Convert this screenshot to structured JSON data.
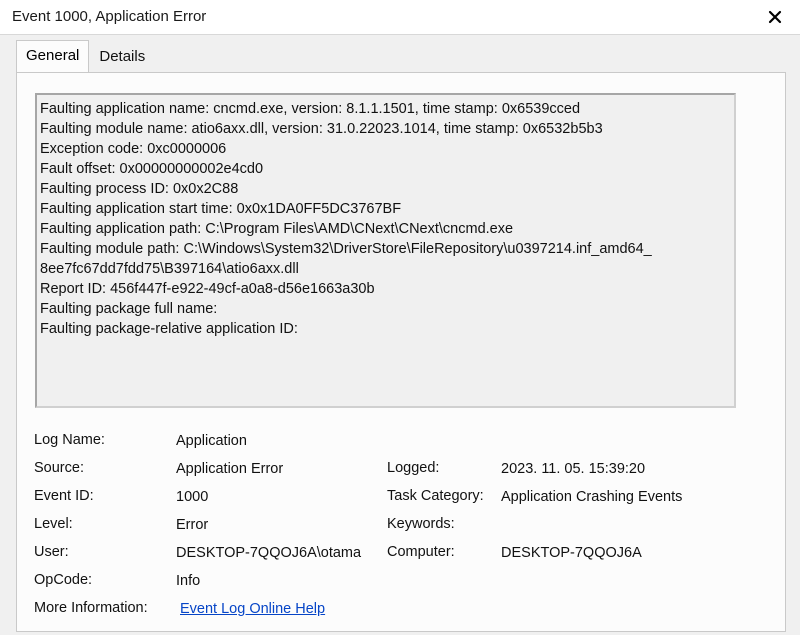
{
  "window": {
    "title": "Event 1000, Application Error",
    "close_icon": "close-icon"
  },
  "tabs": [
    {
      "label": "General",
      "active": true
    },
    {
      "label": "Details",
      "active": false
    }
  ],
  "description": {
    "lines": [
      "Faulting application name: cncmd.exe, version: 8.1.1.1501, time stamp: 0x6539cced",
      "Faulting module name: atio6axx.dll, version: 31.0.22023.1014, time stamp: 0x6532b5b3",
      "Exception code: 0xc0000006",
      "Fault offset: 0x00000000002e4cd0",
      "Faulting process ID: 0x0x2C88",
      "Faulting application start time: 0x0x1DA0FF5DC3767BF",
      "Faulting application path: C:\\Program Files\\AMD\\CNext\\CNext\\cncmd.exe",
      "Faulting module path: C:\\Windows\\System32\\DriverStore\\FileRepository\\u0397214.inf_amd64_",
      "8ee7fc67dd7fdd75\\B397164\\atio6axx.dll",
      "Report ID: 456f447f-e922-49cf-a0a8-d56e1663a30b",
      "Faulting package full name:",
      "Faulting package-relative application ID:"
    ]
  },
  "details": {
    "log_name": {
      "label": "Log Name:",
      "value": "Application"
    },
    "source": {
      "label": "Source:",
      "value": "Application Error"
    },
    "logged": {
      "label": "Logged:",
      "value": "2023. 11. 05. 15:39:20"
    },
    "event_id": {
      "label": "Event ID:",
      "value": "1000"
    },
    "task_category": {
      "label": "Task Category:",
      "value": "Application Crashing Events"
    },
    "level": {
      "label": "Level:",
      "value": "Error"
    },
    "keywords": {
      "label": "Keywords:",
      "value": ""
    },
    "user": {
      "label": "User:",
      "value": "DESKTOP-7QQOJ6A\\otama"
    },
    "computer": {
      "label": "Computer:",
      "value": "DESKTOP-7QQOJ6A"
    },
    "opcode": {
      "label": "OpCode:",
      "value": "Info"
    },
    "more_info": {
      "label": "More Information:",
      "link": "Event Log Online Help"
    }
  }
}
